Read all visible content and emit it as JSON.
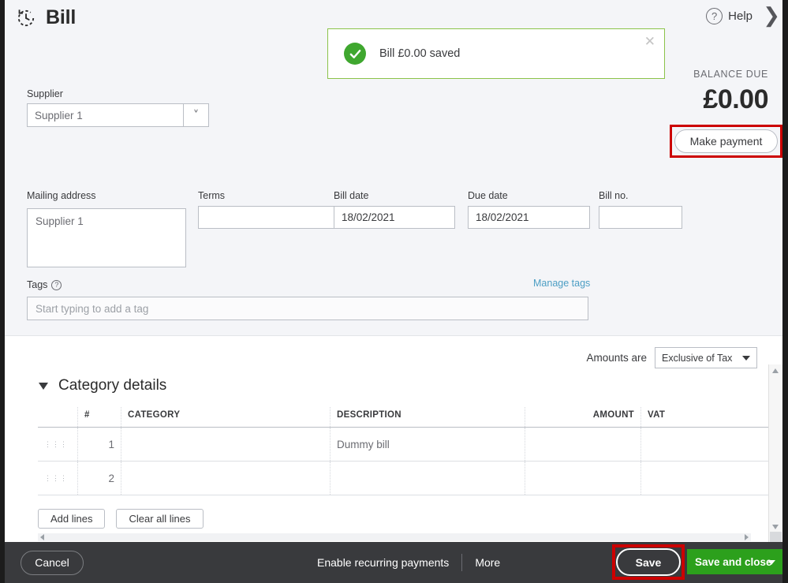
{
  "header": {
    "title": "Bill",
    "recurring_icon": "recurring-clock-icon",
    "help_label": "Help",
    "help_icon": "question-mark-icon",
    "collapse_icon": "chevron-right-icon"
  },
  "banner": {
    "message": "Bill £0.00 saved",
    "status_icon": "check-circle-icon",
    "close_icon": "close-x-icon",
    "border_color": "#8bc34a",
    "check_color": "#3fa72f"
  },
  "balance": {
    "label": "BALANCE DUE",
    "amount": "£0.00",
    "make_payment_label": "Make payment",
    "highlight_color": "#cc0000"
  },
  "form": {
    "supplier_label": "Supplier",
    "supplier_value": "Supplier 1",
    "supplier_caret_icon": "chevron-down-icon",
    "mailing_label": "Mailing address",
    "mailing_value": "Supplier 1",
    "terms_label": "Terms",
    "terms_value": "",
    "terms_caret_icon": "caret-down-icon",
    "bill_date_label": "Bill date",
    "bill_date_value": "18/02/2021",
    "due_date_label": "Due date",
    "due_date_value": "18/02/2021",
    "bill_no_label": "Bill no.",
    "bill_no_value": ""
  },
  "tags": {
    "label": "Tags",
    "help_icon": "question-mark-icon",
    "manage_link": "Manage tags",
    "placeholder": "Start typing to add a tag",
    "value": "",
    "link_color": "#4c9ec4"
  },
  "amounts": {
    "label": "Amounts are",
    "value": "Exclusive of Tax",
    "caret_icon": "caret-down-icon"
  },
  "category_section": {
    "toggle_icon": "triangle-down-icon",
    "title": "Category details",
    "columns": [
      "",
      "#",
      "CATEGORY",
      "DESCRIPTION",
      "AMOUNT",
      "VAT",
      ""
    ],
    "rows": [
      {
        "drag_icon": "drag-handle-icon",
        "num": "1",
        "category": "",
        "description": "Dummy bill",
        "amount": "",
        "vat": "",
        "delete_icon": "trash-icon"
      },
      {
        "drag_icon": "drag-handle-icon",
        "num": "2",
        "category": "",
        "description": "",
        "amount": "",
        "vat": "",
        "delete_icon": "trash-icon"
      }
    ],
    "add_lines_label": "Add lines",
    "clear_lines_label": "Clear all lines"
  },
  "footer": {
    "cancel_label": "Cancel",
    "recurring_label": "Enable recurring payments",
    "more_label": "More",
    "save_label": "Save",
    "save_close_label": "Save and close",
    "save_close_caret_icon": "caret-down-icon",
    "background": "#393a3d",
    "save_close_color": "#2ca01c",
    "save_highlight_color": "#cc0000"
  }
}
